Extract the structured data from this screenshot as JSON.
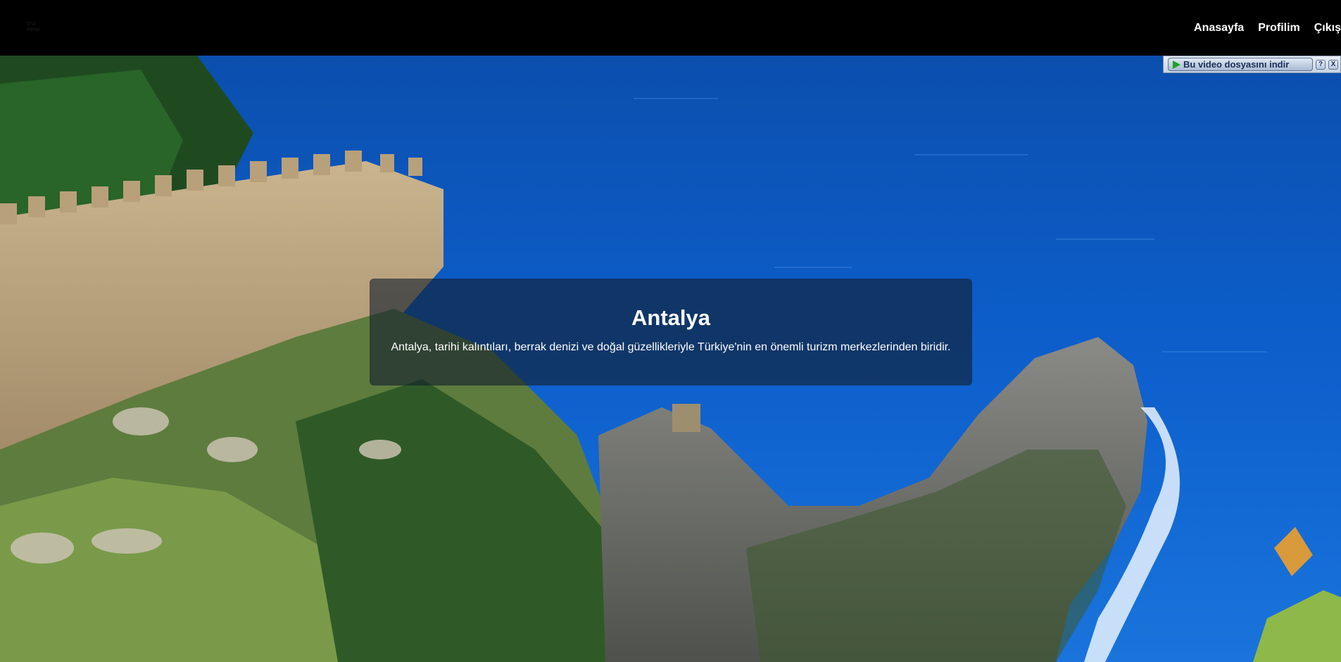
{
  "logo": {
    "text": "Ch2 Rehbr"
  },
  "nav": {
    "items": [
      {
        "label": "Anasayfa"
      },
      {
        "label": "Profilim"
      },
      {
        "label": "Çıkış"
      }
    ]
  },
  "video_download": {
    "label": "Bu video dosyasını indir",
    "help": "?",
    "close": "X"
  },
  "hero": {
    "title": "Antalya",
    "description": "Antalya, tarihi kalıntıları, berrak denizi ve doğal güzellikleriyle Türkiye'nin en önemli turizm merkezlerinden biridir."
  },
  "colors": {
    "navbar": "#000000",
    "sea": "#0a5ccc",
    "overlay": "rgba(20,30,45,0.62)"
  }
}
